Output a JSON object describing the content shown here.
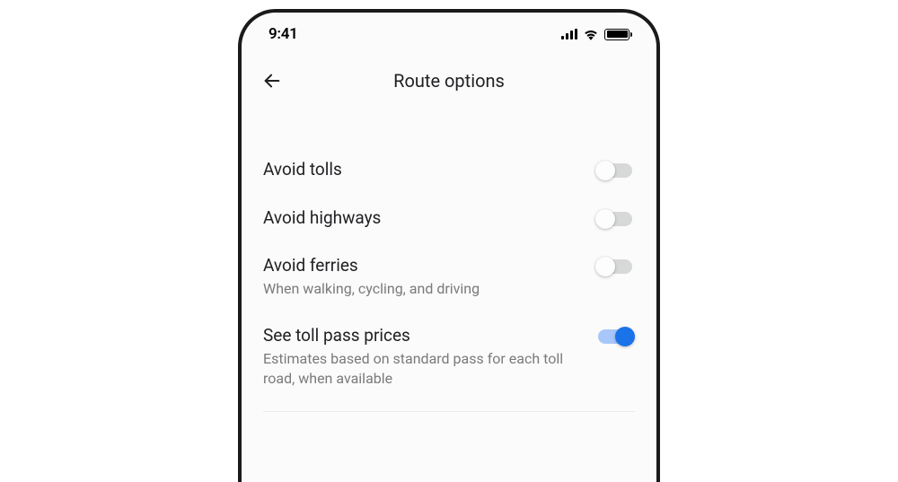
{
  "status_bar": {
    "time": "9:41"
  },
  "header": {
    "title": "Route options"
  },
  "settings": {
    "avoid_tolls": {
      "label": "Avoid tolls",
      "on": false
    },
    "avoid_highways": {
      "label": "Avoid highways",
      "on": false
    },
    "avoid_ferries": {
      "label": "Avoid ferries",
      "sub": "When walking, cycling, and driving",
      "on": false
    },
    "toll_pass_prices": {
      "label": "See toll pass prices",
      "sub": "Estimates based on standard pass for each toll road, when available",
      "on": true
    }
  },
  "colors": {
    "accent": "#1a73e8",
    "accent_light": "#a7c7fa",
    "text_primary": "#202124",
    "text_secondary": "#7a7a7a",
    "toggle_off_track": "#d7d8d8"
  }
}
